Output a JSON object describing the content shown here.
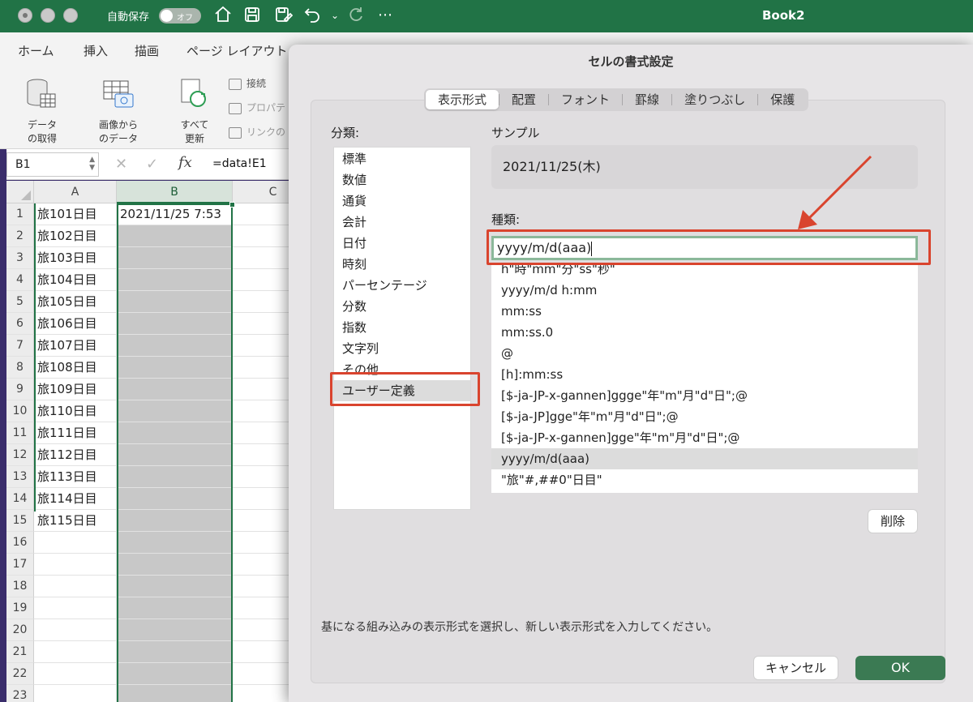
{
  "titlebar": {
    "autosave_label": "自動保存",
    "autosave_state": "オフ",
    "book_title": "Book2",
    "icons": [
      "home-icon",
      "save-icon",
      "save-as-icon",
      "undo-icon",
      "redo-icon",
      "more-icon"
    ]
  },
  "ribbon": {
    "tabs": [
      "ホーム",
      "挿入",
      "描画",
      "ページ レイアウト"
    ],
    "groups": {
      "get_data": "データ\nの取得",
      "from_image": "画像から\nのデータ",
      "refresh_all": "すべて\n更新"
    },
    "small_items": [
      "接続",
      "プロパテ",
      "リンクの"
    ]
  },
  "formula_bar": {
    "name_box": "B1",
    "fx": "fx",
    "formula": "=data!E1"
  },
  "sheet": {
    "columns": [
      "A",
      "B",
      "C"
    ],
    "rows": [
      "1",
      "2",
      "3",
      "4",
      "5",
      "6",
      "7",
      "8",
      "9",
      "10",
      "11",
      "12",
      "13",
      "14",
      "15",
      "16",
      "17",
      "18",
      "19",
      "20",
      "21",
      "22",
      "23"
    ],
    "colA": [
      "旅101日目",
      "旅102日目",
      "旅103日目",
      "旅104日目",
      "旅105日目",
      "旅106日目",
      "旅107日目",
      "旅108日目",
      "旅109日目",
      "旅110日目",
      "旅111日目",
      "旅112日目",
      "旅113日目",
      "旅114日目",
      "旅115日目"
    ],
    "b1": "2021/11/25 7:53"
  },
  "dialog": {
    "title": "セルの書式設定",
    "tabs": [
      "表示形式",
      "配置",
      "フォント",
      "罫線",
      "塗りつぶし",
      "保護"
    ],
    "active_tab": "表示形式",
    "category_label": "分類:",
    "categories": [
      "標準",
      "数値",
      "通貨",
      "会計",
      "日付",
      "時刻",
      "パーセンテージ",
      "分数",
      "指数",
      "文字列",
      "その他",
      "ユーザー定義"
    ],
    "selected_category": "ユーザー定義",
    "sample_label": "サンプル",
    "sample_value": "2021/11/25(木)",
    "type_label": "種類:",
    "type_value": "yyyy/m/d(aaa)",
    "formats": [
      "h\"時\"mm\"分\"ss\"秒\"",
      "yyyy/m/d h:mm",
      "mm:ss",
      "mm:ss.0",
      "@",
      "[h]:mm:ss",
      "[$-ja-JP-x-gannen]ggge\"年\"m\"月\"d\"日\";@",
      "[$-ja-JP]gge\"年\"m\"月\"d\"日\";@",
      "[$-ja-JP-x-gannen]gge\"年\"m\"月\"d\"日\";@",
      "yyyy/m/d(aaa)",
      "\"旅\"#,##0\"日目\""
    ],
    "selected_format": "yyyy/m/d(aaa)",
    "delete_label": "削除",
    "hint": "基になる組み込みの表示形式を選択し、新しい表示形式を入力してください。",
    "cancel_label": "キャンセル",
    "ok_label": "OK",
    "annotation_color": "#d9442e",
    "accent_color": "#217346"
  }
}
